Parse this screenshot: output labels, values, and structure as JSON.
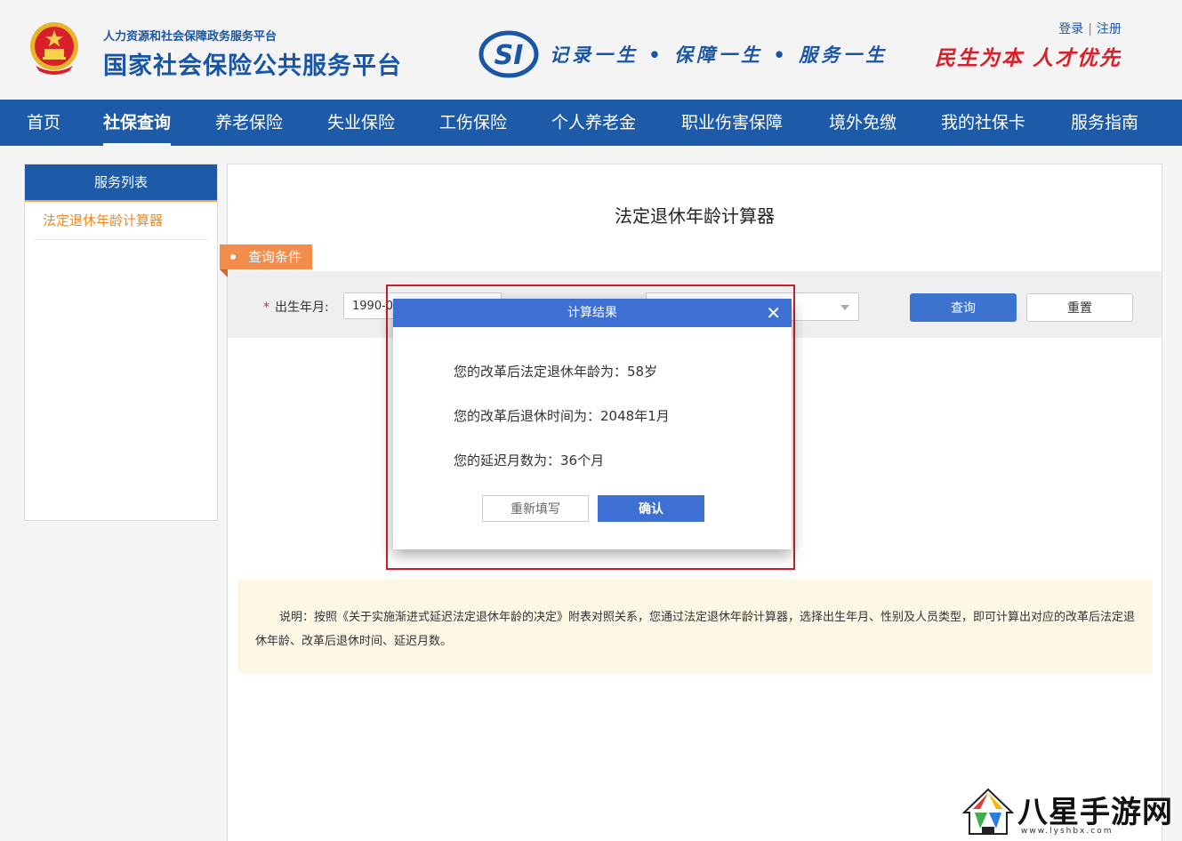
{
  "header": {
    "subtitle": "人力资源和社会保障政务服务平台",
    "title": "国家社会保险公共服务平台",
    "slogan": "记录一生 • 保障一生 • 服务一生",
    "login": "登录",
    "auth_sep": "|",
    "register": "注册",
    "motto": "民生为本 人才优先"
  },
  "nav": {
    "items": [
      "首页",
      "社保查询",
      "养老保险",
      "失业保险",
      "工伤保险",
      "个人养老金",
      "职业伤害保障",
      "境外免缴",
      "我的社保卡",
      "服务指南"
    ],
    "active_index": 1
  },
  "sidebar": {
    "title": "服务列表",
    "items": [
      "法定退休年龄计算器"
    ]
  },
  "main": {
    "title": "法定退休年龄计算器",
    "condition_tag": "查询条件",
    "birth_label": "出生年月:",
    "required_mark": "*",
    "birth_value": "1990-01",
    "query_button": "查询",
    "reset_button": "重置",
    "note": "说明：按照《关于实施渐进式延迟法定退休年龄的决定》附表对照关系，您通过法定退休年龄计算器，选择出生年月、性别及人员类型，即可计算出对应的改革后法定退休年龄、改革后退休时间、延迟月数。"
  },
  "modal": {
    "title": "计算结果",
    "close": "✕",
    "lines": [
      "您的改革后法定退休年龄为：58岁",
      "您的改革后退休时间为：2048年1月",
      "您的延迟月数为：36个月"
    ],
    "refill_button": "重新填写",
    "confirm_button": "确认"
  },
  "watermark": {
    "text": "八星手游网",
    "url": "www.lyshbx.com"
  },
  "colors": {
    "brand_blue": "#1d5aa8",
    "accent_orange": "#f48d4c",
    "highlight_red": "#d01c2a",
    "motto_red": "#d8202a"
  }
}
